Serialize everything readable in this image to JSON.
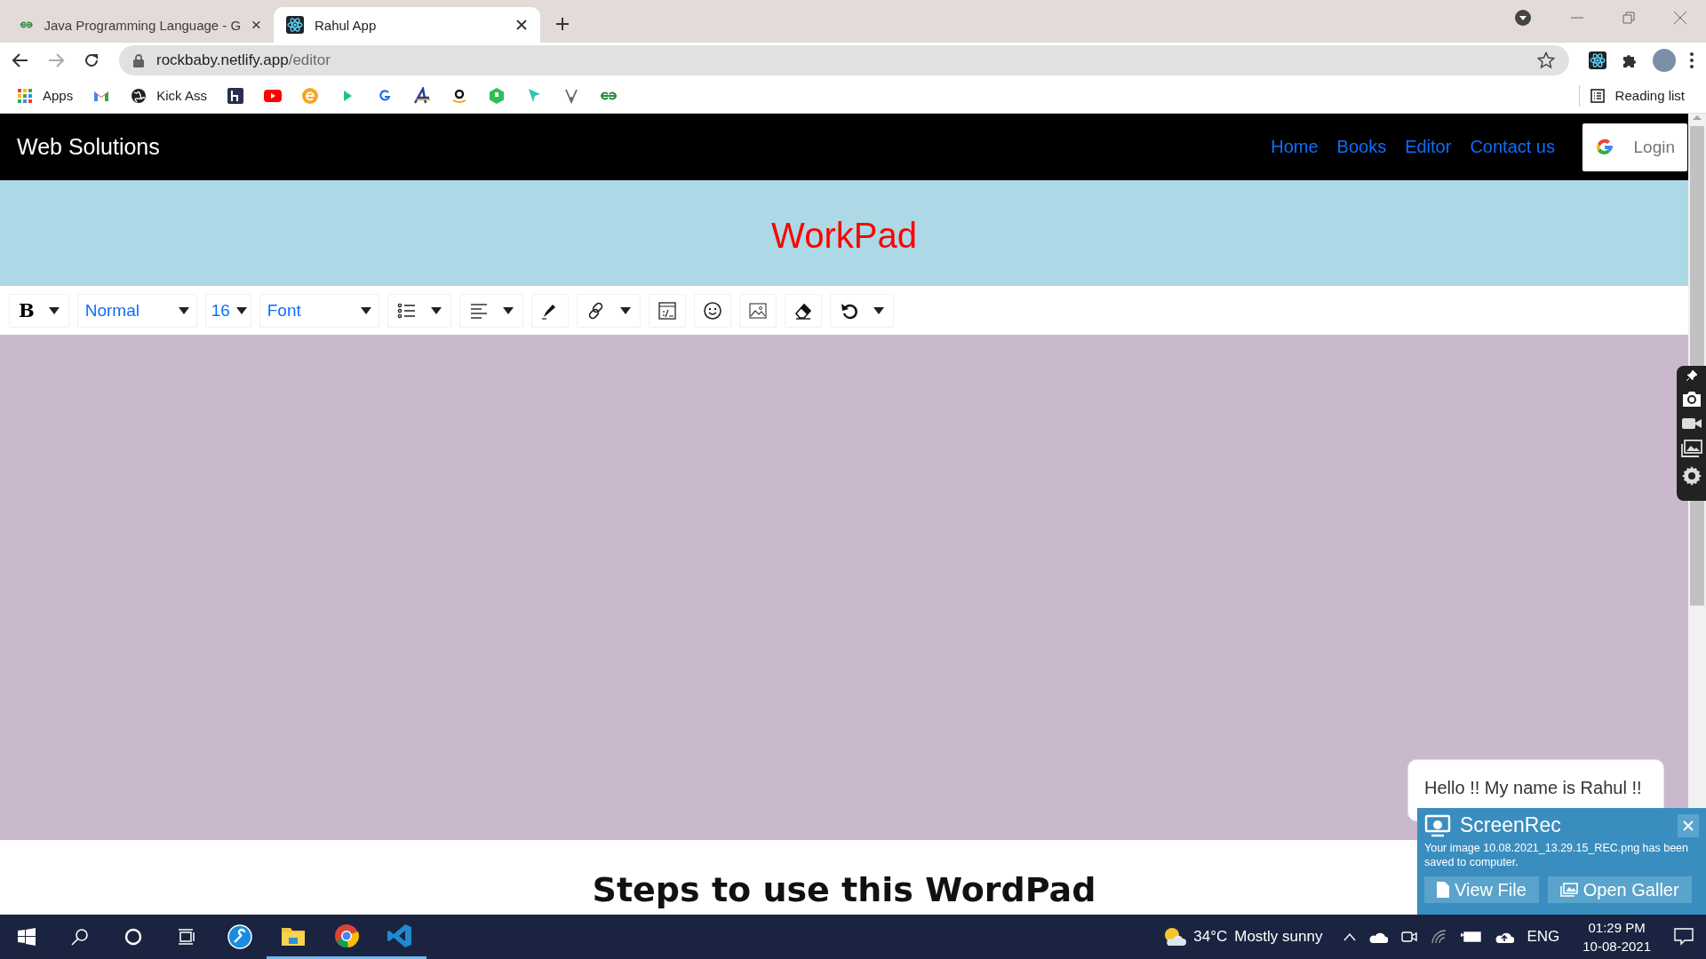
{
  "browser": {
    "tabs": [
      {
        "title": "Java Programming Language - G",
        "kind": "gfg",
        "selected": false
      },
      {
        "title": "Rahul App",
        "kind": "react",
        "selected": true
      }
    ],
    "address": {
      "host": "rockbaby.netlify.app",
      "path": "/editor"
    },
    "forward_disabled": true,
    "bookmarks": [
      {
        "kind": "apps",
        "label": "Apps"
      },
      {
        "kind": "gmail"
      },
      {
        "kind": "globe",
        "label": "Kick Ass"
      },
      {
        "kind": "h"
      },
      {
        "kind": "youtube"
      },
      {
        "kind": "e"
      },
      {
        "kind": "play"
      },
      {
        "kind": "g"
      },
      {
        "kind": "a"
      },
      {
        "kind": "amazon"
      },
      {
        "kind": "hex"
      },
      {
        "kind": "cursor"
      },
      {
        "kind": "v"
      },
      {
        "kind": "gfg"
      }
    ],
    "reading_list": "Reading list"
  },
  "navbar": {
    "brand": "Web Solutions",
    "links": [
      "Home",
      "Books",
      "Editor",
      "Contact us"
    ],
    "login": "Login"
  },
  "header": {
    "title": "WorkPad"
  },
  "toolbar": [
    {
      "kind": "bold",
      "label": "B",
      "dropdown": true
    },
    {
      "kind": "select",
      "value": "Normal"
    },
    {
      "kind": "size",
      "value": "16"
    },
    {
      "kind": "select",
      "value": "Font"
    },
    {
      "kind": "list",
      "dropdown": true
    },
    {
      "kind": "align",
      "dropdown": true
    },
    {
      "kind": "pen",
      "dropdown": false
    },
    {
      "kind": "link",
      "dropdown": true
    },
    {
      "kind": "embed",
      "dropdown": false
    },
    {
      "kind": "emoji",
      "dropdown": false
    },
    {
      "kind": "image",
      "dropdown": false
    },
    {
      "kind": "eraser",
      "dropdown": false
    },
    {
      "kind": "undo",
      "dropdown": true
    }
  ],
  "steps_heading": "Steps to use this WordPad",
  "chat_bubble": "Hello !! My name is Rahul !!",
  "notification": {
    "title": "ScreenRec",
    "message": "Your image 10.08.2021_13.29.15_REC.png has been saved to computer.",
    "buttons": [
      {
        "kind": "file",
        "label": "View File"
      },
      {
        "kind": "gallery",
        "label": "Open Galler"
      }
    ]
  },
  "taskbar": {
    "apps": [
      {
        "kind": "tool",
        "open": false
      },
      {
        "kind": "folder",
        "open": true
      },
      {
        "kind": "chrome",
        "open": true
      },
      {
        "kind": "vscode",
        "open": true
      }
    ],
    "temperature": "34°C",
    "weather": "Mostly sunny",
    "language": "ENG",
    "time": "01:29 PM",
    "date": "10-08-2021"
  }
}
